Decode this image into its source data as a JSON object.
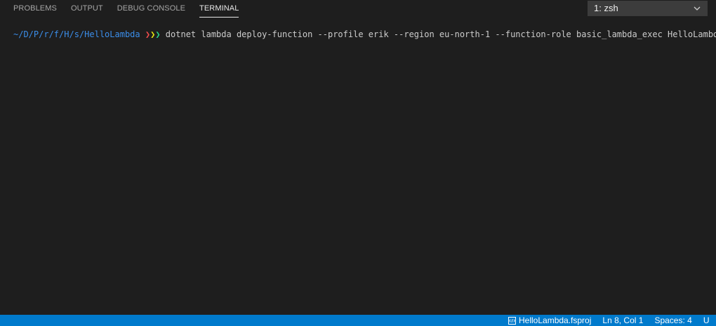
{
  "panel": {
    "tabs": [
      {
        "label": "PROBLEMS"
      },
      {
        "label": "OUTPUT"
      },
      {
        "label": "DEBUG CONSOLE"
      },
      {
        "label": "TERMINAL"
      }
    ],
    "active_tab": "TERMINAL",
    "terminal_select": {
      "value": "1: zsh"
    }
  },
  "terminal": {
    "prompt_path": "~/D/P/r/f/H/s/HelloLambda",
    "prompt_arrows": [
      "❯",
      "❯",
      "❯"
    ],
    "command": "dotnet lambda deploy-function --profile erik --region eu-north-1 --function-role basic_lambda_exec HelloLambda",
    "colors": {
      "path": "#3b8eea",
      "arrow_red": "#f14c4c",
      "arrow_yellow": "#e5e510",
      "arrow_green": "#23d18b"
    }
  },
  "statusbar": {
    "file": "HelloLambda.fsproj",
    "file_icon": "file-code-icon",
    "position": "Ln 8, Col 1",
    "spaces": "Spaces: 4",
    "encoding_partial": "U",
    "background": "#007acc"
  }
}
